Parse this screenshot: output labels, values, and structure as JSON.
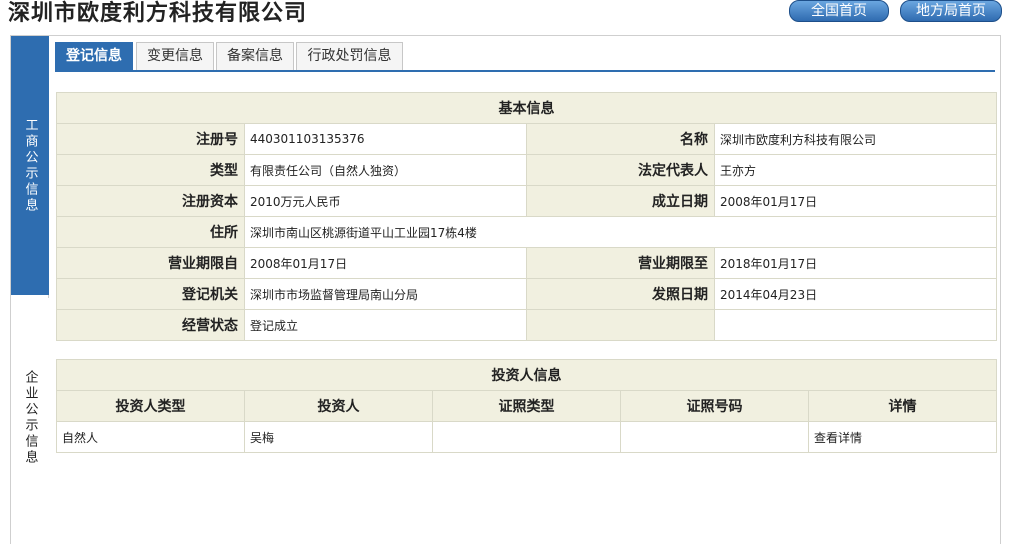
{
  "header": {
    "company_name": "深圳市欧度利方科技有限公司",
    "national_home": "全国首页",
    "local_home": "地方局首页"
  },
  "side_nav": {
    "top_label": "工商公示信息",
    "bottom_label": "企业公示信息"
  },
  "tabs": [
    {
      "label": "登记信息",
      "active": true
    },
    {
      "label": "变更信息",
      "active": false
    },
    {
      "label": "备案信息",
      "active": false
    },
    {
      "label": "行政处罚信息",
      "active": false
    }
  ],
  "basic_info": {
    "caption": "基本信息",
    "reg_no_label": "注册号",
    "reg_no": "440301103135376",
    "name_label": "名称",
    "name": "深圳市欧度利方科技有限公司",
    "type_label": "类型",
    "type": "有限责任公司（自然人独资）",
    "legal_rep_label": "法定代表人",
    "legal_rep": "王亦方",
    "capital_label": "注册资本",
    "capital": "2010万元人民币",
    "founded_label": "成立日期",
    "founded": "2008年01月17日",
    "address_label": "住所",
    "address": "深圳市南山区桃源街道平山工业园17栋4楼",
    "term_from_label": "营业期限自",
    "term_from": "2008年01月17日",
    "term_to_label": "营业期限至",
    "term_to": "2018年01月17日",
    "authority_label": "登记机关",
    "authority": "深圳市市场监督管理局南山分局",
    "issue_date_label": "发照日期",
    "issue_date": "2014年04月23日",
    "status_label": "经营状态",
    "status": "登记成立"
  },
  "investors": {
    "caption": "投资人信息",
    "headers": [
      "投资人类型",
      "投资人",
      "证照类型",
      "证照号码",
      "详情"
    ],
    "rows": [
      {
        "type": "自然人",
        "name": "吴梅",
        "id_type": "",
        "id_no": "",
        "detail": "查看详情"
      }
    ]
  }
}
